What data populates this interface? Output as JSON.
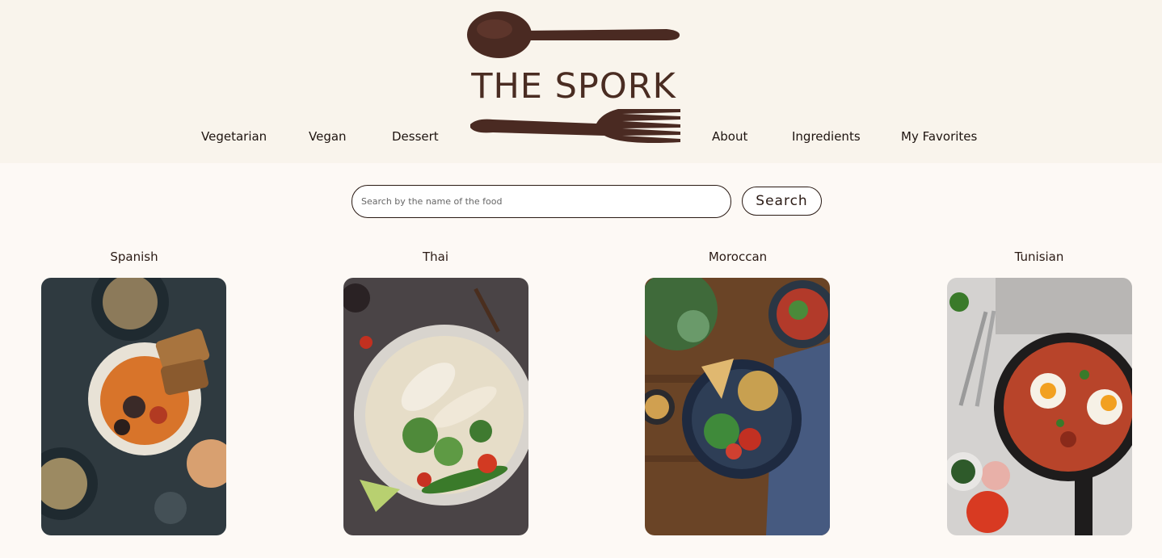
{
  "brand": {
    "name": "THE SPORK"
  },
  "nav": {
    "left": [
      {
        "label": "Vegetarian"
      },
      {
        "label": "Vegan"
      },
      {
        "label": "Dessert"
      }
    ],
    "right": [
      {
        "label": "About"
      },
      {
        "label": "Ingredients"
      },
      {
        "label": "My Favorites"
      }
    ]
  },
  "search": {
    "placeholder": "Search by the name of the food",
    "value": "",
    "button_label": "Search"
  },
  "categories": [
    {
      "label": "Spanish"
    },
    {
      "label": "Thai"
    },
    {
      "label": "Moroccan"
    },
    {
      "label": "Tunisian"
    }
  ],
  "colors": {
    "brand_brown": "#4a2c22",
    "header_bg": "#f9f4ec",
    "page_bg": "#fdf9f5"
  }
}
